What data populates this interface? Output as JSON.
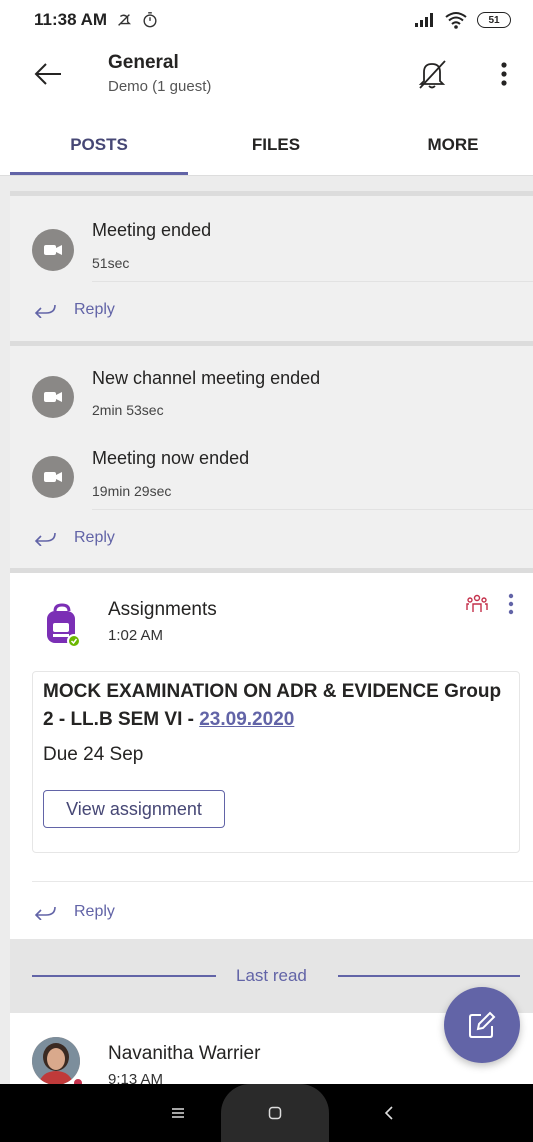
{
  "status_bar": {
    "time": "11:38 AM",
    "battery": "51"
  },
  "header": {
    "title": "General",
    "subtitle": "Demo (1 guest)"
  },
  "tabs": [
    {
      "label": "POSTS",
      "active": true
    },
    {
      "label": "FILES",
      "active": false
    },
    {
      "label": "MORE",
      "active": false
    }
  ],
  "feed": {
    "meeting_card_1": {
      "items": [
        {
          "title": "Meeting ended",
          "duration": "51sec"
        }
      ],
      "reply_label": "Reply"
    },
    "meeting_card_2": {
      "items": [
        {
          "title": "New channel meeting ended",
          "duration": "2min 53sec"
        },
        {
          "title": "Meeting now ended",
          "duration": "19min 29sec"
        }
      ],
      "reply_label": "Reply"
    },
    "assignment_post": {
      "author": "Assignments",
      "time": "1:02 AM",
      "title_prefix": "MOCK EXAMINATION ON ADR & EVIDENCE Group 2 - LL.B SEM VI - ",
      "title_link": "23.09.2020",
      "due": "Due 24 Sep",
      "button_label": "View assignment",
      "reply_label": "Reply"
    },
    "last_read_label": "Last read",
    "next_post": {
      "author": "Navanitha Warrier",
      "time": "9:13 AM"
    }
  },
  "colors": {
    "accent": "#6264a7",
    "accent_dark": "#464775",
    "presence_available": "#6bb700",
    "presence_busy": "#c4314b"
  },
  "icons": {
    "back": "arrow-left-icon",
    "bell": "bell-off-icon",
    "more": "more-vertical-icon",
    "meeting": "video-camera-icon",
    "reply": "reply-arrow-icon",
    "compose": "compose-icon"
  }
}
